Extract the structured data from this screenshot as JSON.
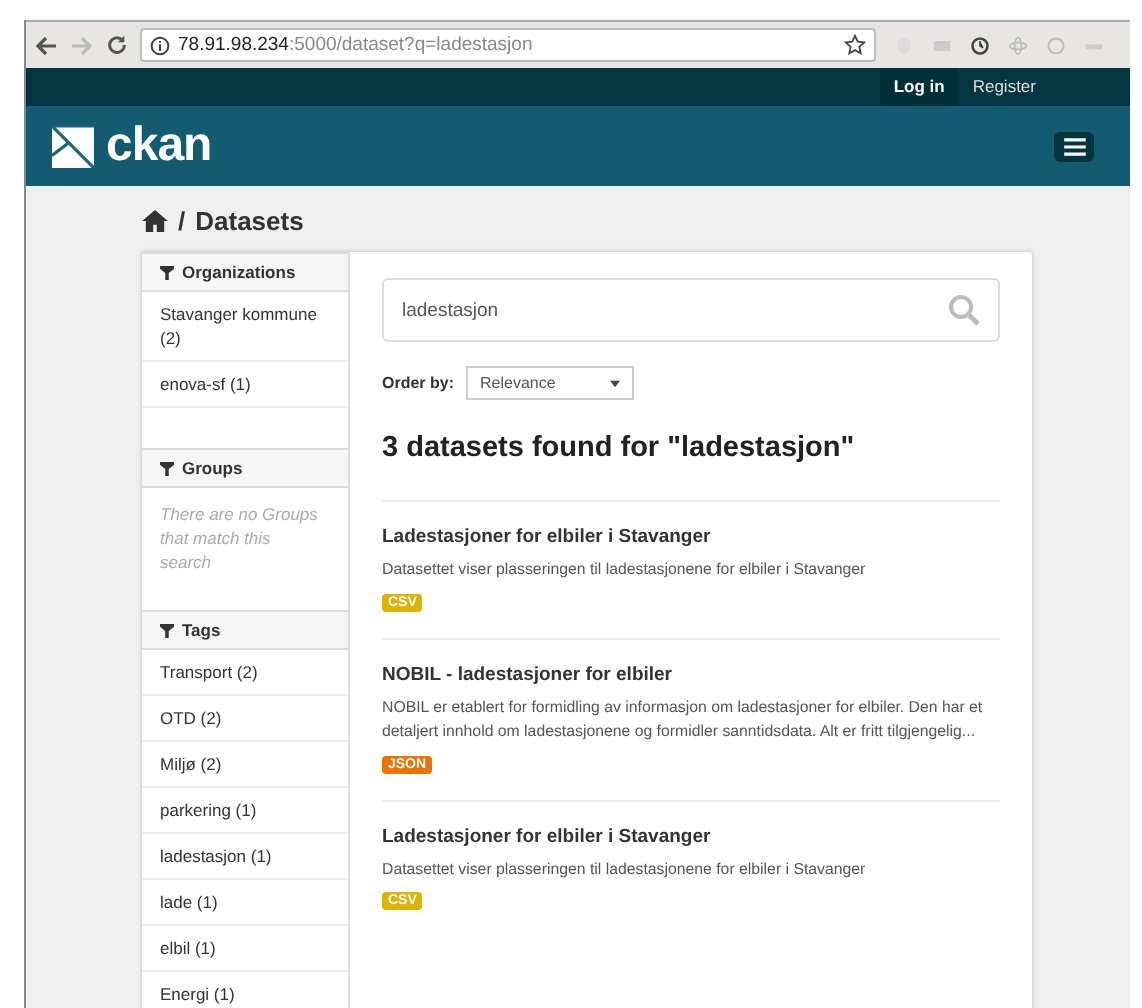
{
  "browser": {
    "url": "**78.91.98.234**:5000/dataset?q=ladestasjon"
  },
  "account_links": [
    {
      "label": "Log in"
    },
    {
      "label": "Register"
    }
  ],
  "site": {
    "logo": "ckan"
  },
  "breadcrumb": {
    "separator": "/",
    "current": "Datasets"
  },
  "facets": [
    {
      "title": "Organizations",
      "items": [
        "Stavanger kommune (2)",
        "enova-sf (1)"
      ]
    },
    {
      "title": "Groups",
      "empty": "There are no Groups that match this search"
    },
    {
      "title": "Tags",
      "items": [
        "Transport (2)",
        "OTD (2)",
        "Miljø (2)",
        "parkering (1)",
        "ladestasjon (1)",
        "lade (1)",
        "elbil (1)",
        "Energi (1)"
      ]
    }
  ],
  "search": {
    "value": "ladestasjon"
  },
  "order_by": {
    "label": "Order by:",
    "value": "Relevance"
  },
  "results_heading": "3 datasets found for \"ladestasjon\"",
  "datasets": [
    {
      "title": "Ladestasjoner for elbiler i Stavanger",
      "description": "Datasettet viser plasseringen til ladestasjonene for elbiler i Stavanger",
      "formats": [
        {
          "label": "CSV",
          "color": "#dfb100"
        }
      ]
    },
    {
      "title": "NOBIL - ladestasjoner for elbiler",
      "description": "NOBIL er etablert for formidling av informasjon om ladestasjoner for elbiler. Den har et detaljert innhold om ladestasjonene og formidler sanntidsdata. Alt er fritt tilgjengelig...",
      "formats": [
        {
          "label": "JSON",
          "color": "#ef7100"
        }
      ]
    },
    {
      "title": "Ladestasjoner for elbiler i Stavanger",
      "description": "Datasettet viser plasseringen til ladestasjonene for elbiler i Stavanger",
      "formats": [
        {
          "label": "CSV",
          "color": "#dfb100"
        }
      ]
    }
  ]
}
